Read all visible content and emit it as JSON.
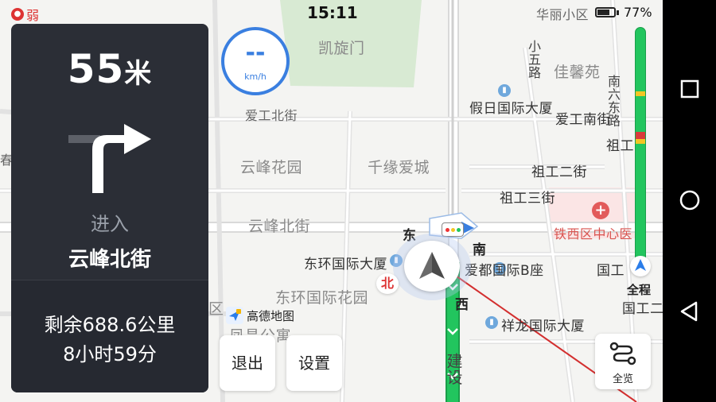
{
  "status": {
    "signal_label": "弱",
    "time": "15:11",
    "battery_percent": "77%",
    "battery_level": 0.77
  },
  "guidance": {
    "distance_value": "55",
    "distance_unit": "米",
    "action": "进入",
    "road_name": "云峰北街",
    "remaining_distance": "剩余688.6公里",
    "remaining_time": "8小时59分"
  },
  "speed": {
    "value": "--",
    "unit": "km/h"
  },
  "map": {
    "labels": {
      "kaixuanmen": "凯旋门",
      "aigong_north": "爱工北街",
      "yunfeng_garden": "云峰花园",
      "qianyuan": "千缘爱城",
      "yunfeng_north": "云峰北街",
      "donghuan_tower": "东环国际大厦",
      "donghuan_garden": "东环国际花园",
      "jiari": "假日国际大厦",
      "aigong_south": "爱工南街",
      "zugong2": "祖工二街",
      "zugong3": "祖工三街",
      "zugong": "祖工",
      "tiexi": "铁西区中心医",
      "aidu": "爱都国际B座",
      "xianglong": "祥龙国际大厦",
      "huali": "华丽小区",
      "jiaxin": "佳馨苑",
      "guogong": "国工",
      "guogong2": "国工二",
      "xiaowu": "小五路",
      "nanliu": "南六东路",
      "jianshe": "建设",
      "apartment": "凤昌公寓",
      "left_fragment1": "春",
      "left_fragment2": "区"
    },
    "directions": {
      "east": "东",
      "south": "南",
      "west": "西",
      "north": "北"
    }
  },
  "brand": {
    "name": "高德地图"
  },
  "buttons": {
    "exit": "退出",
    "settings": "设置",
    "overview": "全览",
    "full_route": "全程"
  },
  "route_progress": {
    "traveled_fraction": 0.0,
    "congestion": [
      {
        "start": 0.27,
        "end": 0.29,
        "level": "slow"
      },
      {
        "start": 0.44,
        "end": 0.47,
        "level": "heavy"
      },
      {
        "start": 0.47,
        "end": 0.49,
        "level": "slow"
      }
    ]
  },
  "colors": {
    "route_green": "#22c55e",
    "slow_yellow": "#f3c623",
    "heavy_red": "#d93b3b",
    "accent_blue": "#3a7fe0",
    "panel_bg": "#2b2e36"
  },
  "icons": {
    "signal": "signal-weak-icon",
    "battery": "battery-icon",
    "turn": "turn-right-arrow-icon",
    "car": "navigation-car-icon",
    "overview": "route-overview-icon",
    "nav_recent": "square-recents-icon",
    "nav_home": "circle-home-icon",
    "nav_back": "triangle-back-icon"
  }
}
